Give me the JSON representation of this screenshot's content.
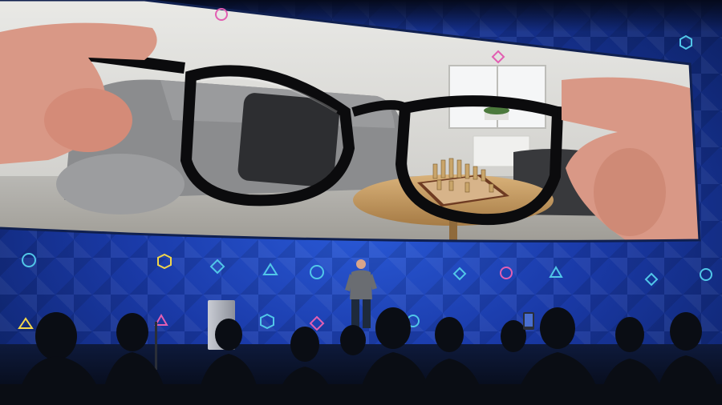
{
  "scene": {
    "colors": {
      "stage_blue": "#1f47c4",
      "stage_dark": "#0c1f5e",
      "screen_wall": "#d9d9d6",
      "glasses_frame": "#0b0b0d",
      "chess_wood": "#c7a061",
      "skin": "#d99886",
      "audience": "#0a0d14"
    },
    "icons": [
      "hexagon-icon",
      "circle-icon",
      "triangle-icon",
      "diamond-icon"
    ]
  }
}
